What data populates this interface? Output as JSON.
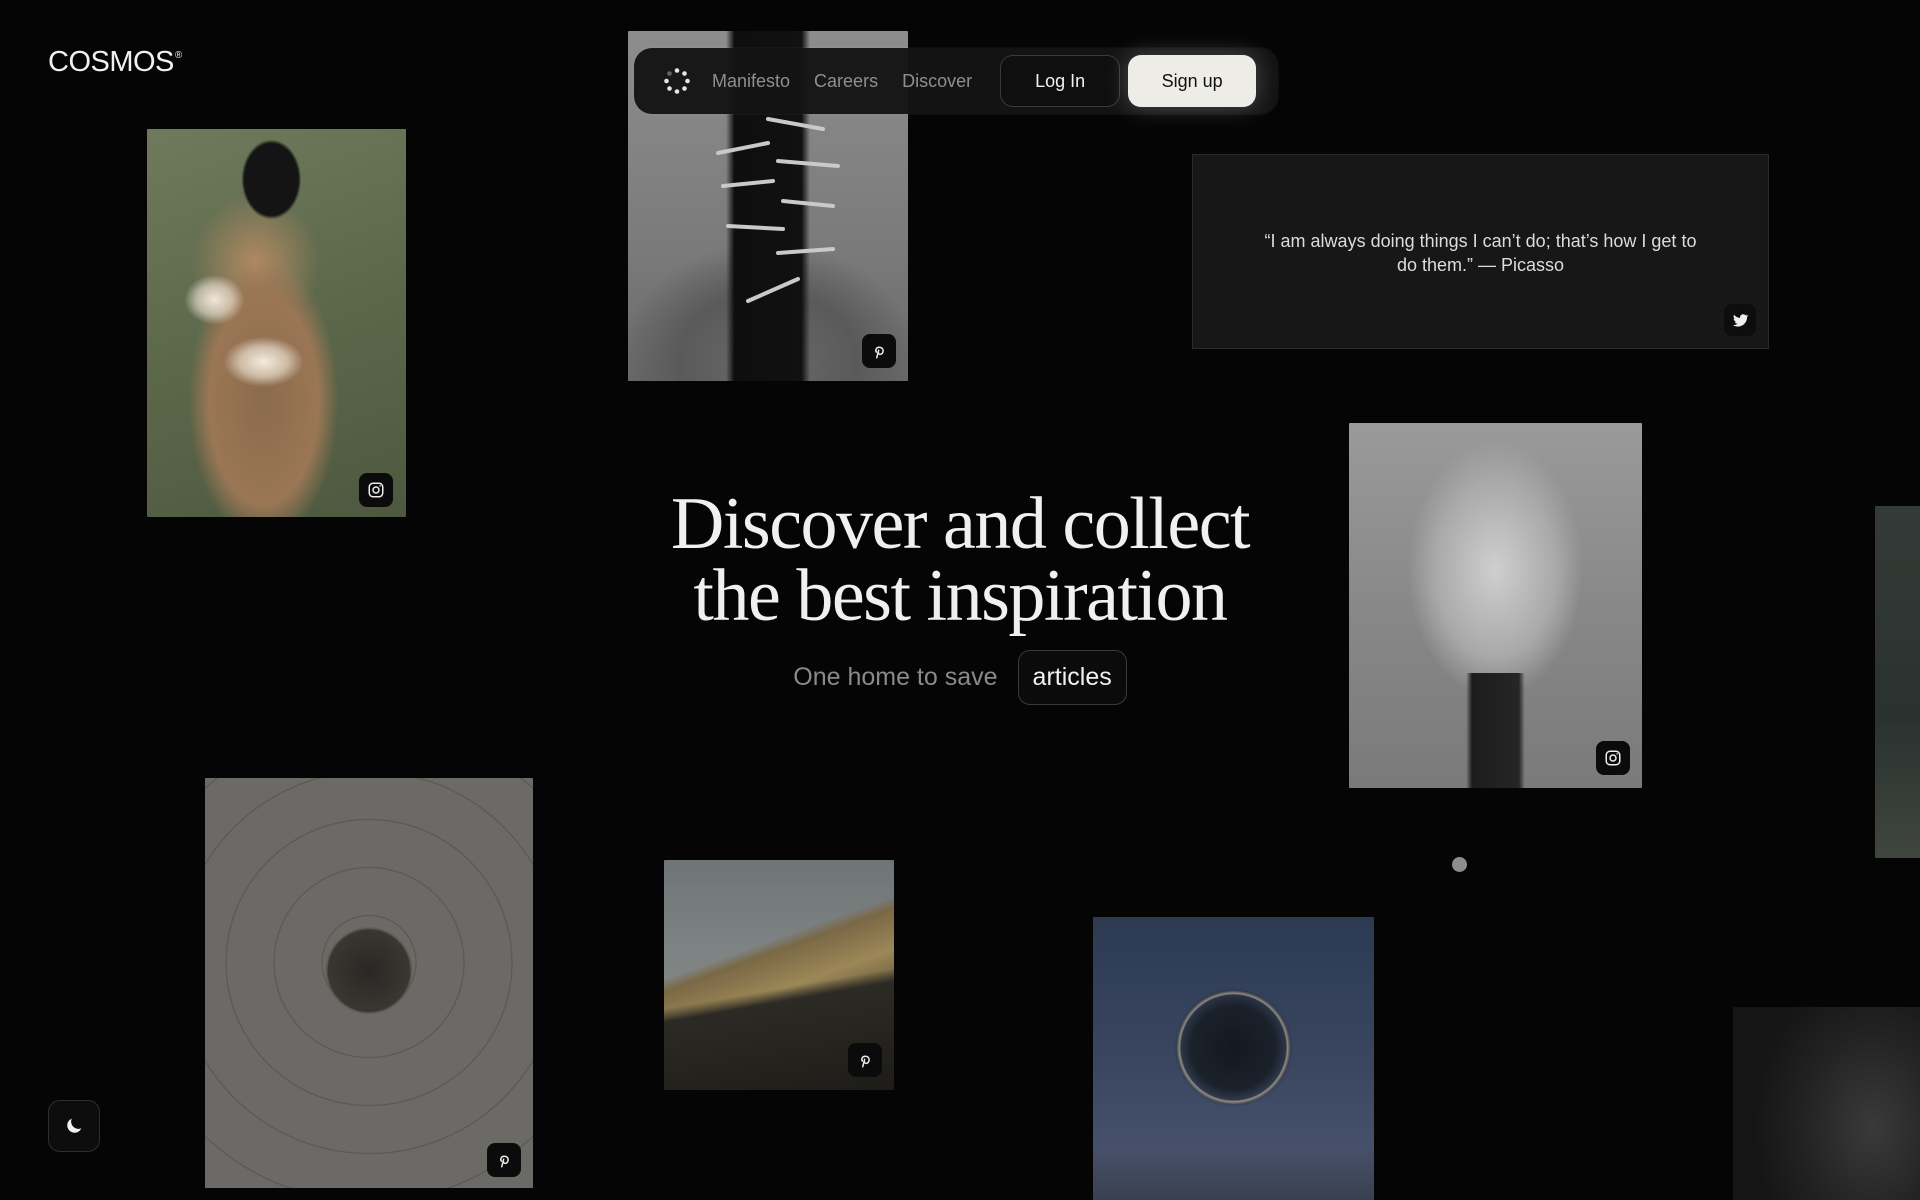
{
  "brand": {
    "name": "COSMOS",
    "mark": "®"
  },
  "nav": {
    "links": [
      "Manifesto",
      "Careers",
      "Discover"
    ],
    "login_label": "Log In",
    "signup_label": "Sign up"
  },
  "quote": {
    "text": "“I am always doing things I can’t do; that’s how I get to do them.” — Picasso",
    "source_icon": "twitter-icon"
  },
  "hero": {
    "title_line1": "Discover and collect",
    "title_line2": "the best inspiration",
    "subtitle": "One home to save",
    "rotating_word": "articles"
  },
  "cards": [
    {
      "id": "card-1",
      "source_icon": "instagram-icon"
    },
    {
      "id": "card-2",
      "source_icon": "pinterest-icon"
    },
    {
      "id": "card-3",
      "source_icon": "instagram-icon"
    },
    {
      "id": "card-4",
      "source_icon": "pinterest-icon"
    },
    {
      "id": "card-5",
      "source_icon": "pinterest-icon"
    },
    {
      "id": "card-6",
      "source_icon": "none"
    }
  ],
  "theme_toggle": {
    "icon": "moon-icon"
  },
  "colors": {
    "background": "#050505",
    "signup_bg": "#eeece6",
    "text_muted": "#8f8f8f"
  }
}
